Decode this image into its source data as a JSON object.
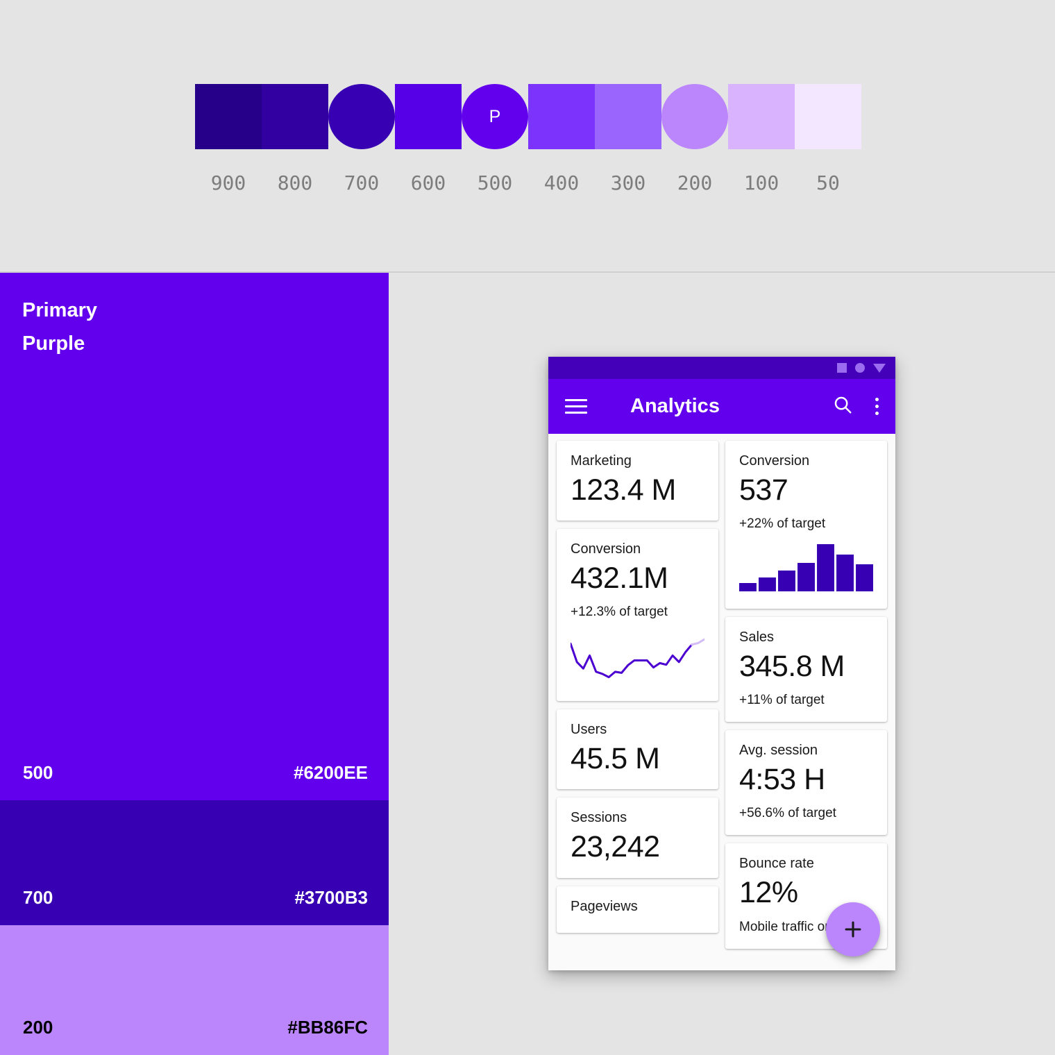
{
  "palette": {
    "swatches": [
      {
        "tone": "900",
        "hex": "#270089",
        "shape": "square",
        "letter": ""
      },
      {
        "tone": "800",
        "hex": "#3200A0",
        "shape": "square",
        "letter": ""
      },
      {
        "tone": "700",
        "hex": "#3700B3",
        "shape": "circle",
        "letter": ""
      },
      {
        "tone": "600",
        "hex": "#5600E8",
        "shape": "square",
        "letter": ""
      },
      {
        "tone": "500",
        "hex": "#6200EE",
        "shape": "circle",
        "letter": "P"
      },
      {
        "tone": "400",
        "hex": "#7C34FC",
        "shape": "square",
        "letter": ""
      },
      {
        "tone": "300",
        "hex": "#9965FC",
        "shape": "square",
        "letter": ""
      },
      {
        "tone": "200",
        "hex": "#BB86FC",
        "shape": "circle",
        "letter": ""
      },
      {
        "tone": "100",
        "hex": "#D9B3FD",
        "shape": "square",
        "letter": ""
      },
      {
        "tone": "50",
        "hex": "#F2E7FE",
        "shape": "square",
        "letter": ""
      }
    ]
  },
  "primary_panel": {
    "title_line1": "Primary",
    "title_line2": "Purple",
    "tones": [
      {
        "name": "500",
        "hex": "#6200EE",
        "text_color": "#FFFFFF"
      },
      {
        "name": "700",
        "hex": "#3700B3",
        "text_color": "#FFFFFF"
      },
      {
        "name": "200",
        "hex": "#BB86FC",
        "text_color": "#000000"
      }
    ]
  },
  "phone": {
    "status_bar": {
      "icons": [
        "square-icon",
        "circle-icon",
        "triangle-down-icon"
      ],
      "background": "#4400B8"
    },
    "app_bar": {
      "title": "Analytics",
      "menu_icon": "hamburger-menu-icon",
      "search_icon": "search-icon",
      "overflow_icon": "more-vertical-icon",
      "background": "#6200EE"
    },
    "cards": {
      "left_column": [
        {
          "label": "Marketing",
          "value": "123.4 M",
          "sub": "",
          "chart": "none"
        },
        {
          "label": "Conversion",
          "value": "432.1M",
          "sub": "+12.3% of target",
          "chart": "sparkline"
        },
        {
          "label": "Users",
          "value": "45.5 M",
          "sub": "",
          "chart": "none"
        },
        {
          "label": "Sessions",
          "value": "23,242",
          "sub": "",
          "chart": "none"
        },
        {
          "label": "Pageviews",
          "value": "",
          "sub": "",
          "chart": "none"
        }
      ],
      "right_column": [
        {
          "label": "Conversion",
          "value": "537",
          "sub": "+22% of target",
          "chart": "bars"
        },
        {
          "label": "Sales",
          "value": "345.8 M",
          "sub": "+11% of target",
          "chart": "none"
        },
        {
          "label": "Avg. session",
          "value": "4:53 H",
          "sub": "+56.6% of target",
          "chart": "none"
        },
        {
          "label": "Bounce rate",
          "value": "12%",
          "sub": "Mobile traffic only",
          "chart": "none"
        }
      ]
    },
    "fab": {
      "icon": "plus-icon",
      "background": "#BB86FC"
    }
  },
  "chart_data": [
    {
      "type": "bar",
      "title": "Conversion",
      "categories": [
        "1",
        "2",
        "3",
        "4",
        "5",
        "6",
        "7"
      ],
      "values": [
        12,
        20,
        30,
        41,
        68,
        53,
        39
      ],
      "ylim": [
        0,
        70
      ],
      "xlabel": "",
      "ylabel": "",
      "grid": false,
      "legend": "none",
      "color": "#3700B3"
    },
    {
      "type": "line",
      "title": "Conversion",
      "x": [
        0,
        1,
        2,
        3,
        4,
        5,
        6,
        7,
        8,
        9,
        10,
        11,
        12,
        13,
        14,
        15,
        16,
        17,
        18,
        19,
        20,
        21
      ],
      "values": [
        74,
        40,
        28,
        52,
        22,
        18,
        12,
        22,
        20,
        34,
        43,
        43,
        43,
        30,
        38,
        35,
        52,
        40,
        58,
        72,
        75,
        82
      ],
      "forecast_from_index": 19,
      "ylim": [
        0,
        100
      ],
      "xlabel": "",
      "ylabel": "",
      "grid": false,
      "legend": "none",
      "color": "#4B00D1",
      "forecast_color": "#D3BBF7"
    }
  ]
}
